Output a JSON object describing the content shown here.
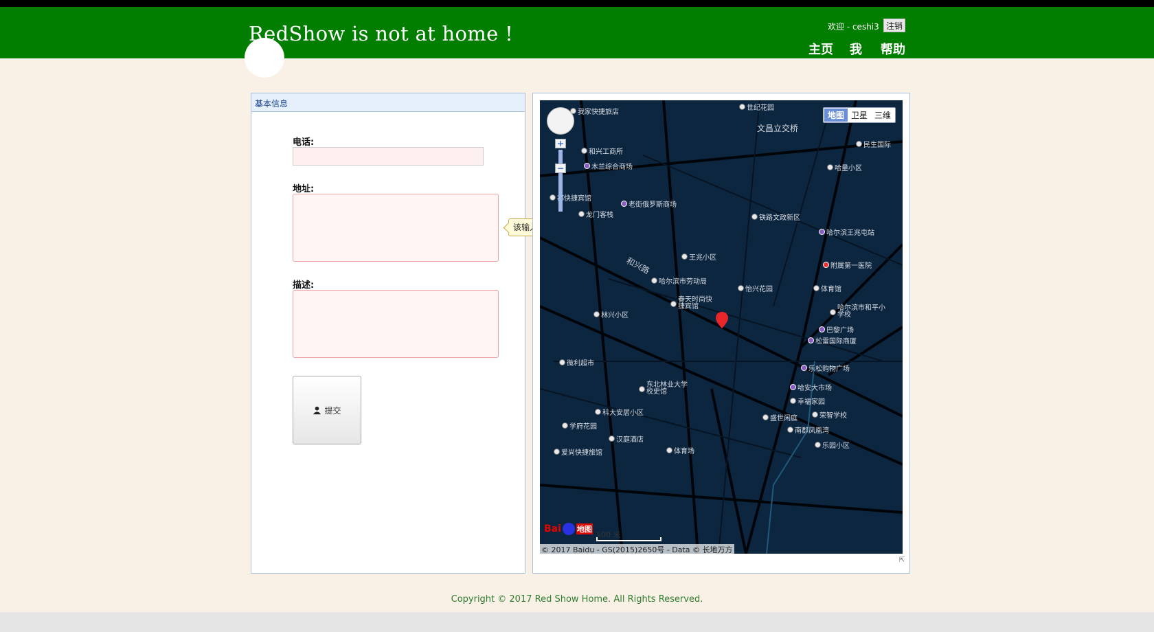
{
  "header": {
    "title": "RedShow is not at home !",
    "welcome": "欢迎 - ceshi3",
    "logout": "注销",
    "nav": {
      "home": "主页",
      "me": "我",
      "help": "帮助"
    }
  },
  "form": {
    "panel_title": "基本信息",
    "phone_label": "电话:",
    "address_label": "地址:",
    "desc_label": "描述:",
    "phone_value": "",
    "address_value": "",
    "desc_value": "",
    "required_tooltip": "该输入项为必输项",
    "submit_label": "提交"
  },
  "map": {
    "type_buttons": [
      "地图",
      "卫星",
      "三维"
    ],
    "active_type": "地图",
    "scale": "500 米",
    "copyright": "© 2017 Baidu - GS(2015)2650号 - Data © 长地万方",
    "logo_text": "Bai",
    "logo_ditu": "地图",
    "road": "和兴路",
    "pois": [
      "我家快捷旅店",
      "世纪花园",
      "文昌立交桥",
      "民生国际",
      "和兴工商所",
      "木兰综合商场",
      "哈量小区",
      "都快捷宾馆",
      "老街俄罗斯商场",
      "龙门客栈",
      "铁路文政新区",
      "哈尔滨王兆屯站",
      "王兆小区",
      "附属第一医院",
      "哈尔滨市劳动局",
      "怡兴花园",
      "体育馆",
      "春天时尚快捷宾馆",
      "林兴小区",
      "哈尔滨市和平小学校",
      "巴黎广场",
      "松雷国际商厦",
      "微利超市",
      "乐松购物广场",
      "东北林业大学校史馆",
      "哈安大市场",
      "幸福家园",
      "科大安居小区",
      "荣智学校",
      "盛世闲庭",
      "学府花园",
      "南郡凤凰湾",
      "汉庭酒店",
      "乐园小区",
      "体育场",
      "爱尚快捷旅馆"
    ]
  },
  "footer": {
    "copyright": "Copyright © 2017 Red Show Home. All Rights Reserved."
  },
  "colors": {
    "header_bg": "#017d00",
    "page_bg": "#f9f0e6",
    "map_bg": "#0d2640",
    "marker": "#e8262a"
  }
}
